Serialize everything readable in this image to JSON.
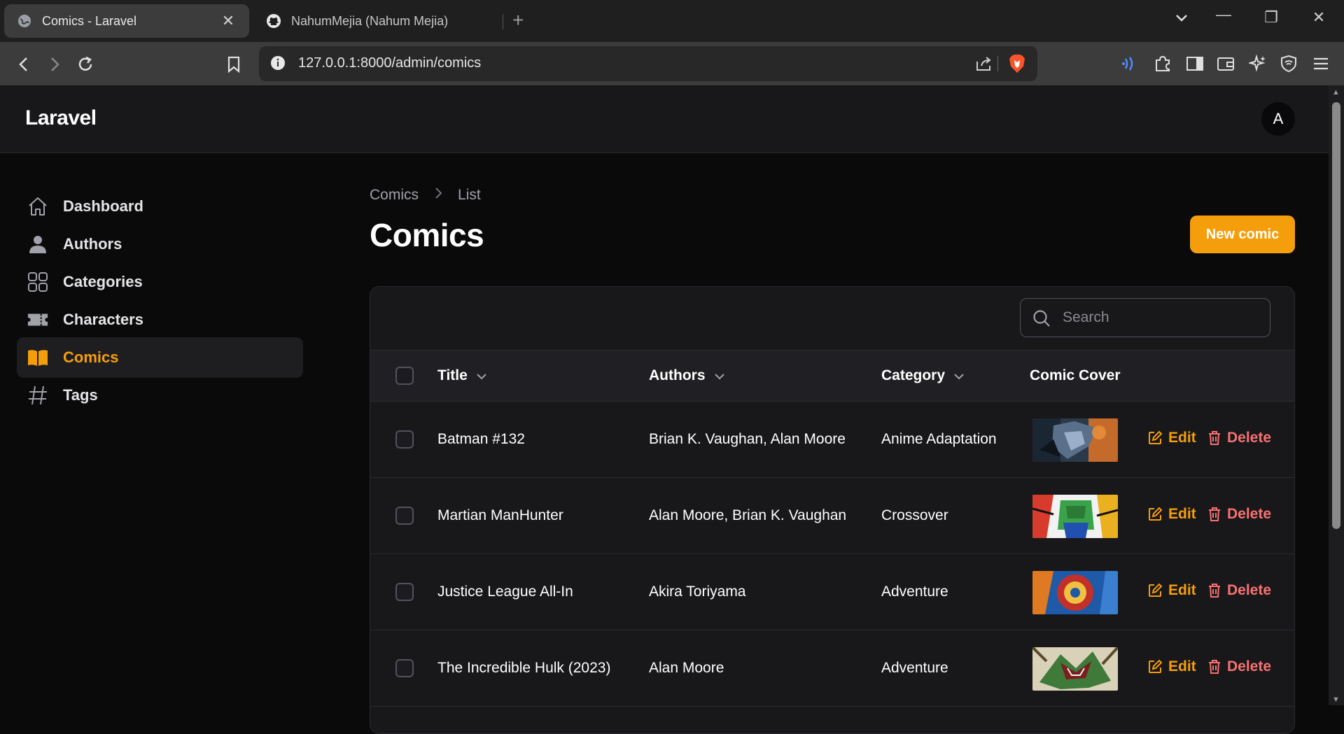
{
  "browser": {
    "tabs": [
      {
        "title": "Comics - Laravel",
        "active": true,
        "close": "✕"
      },
      {
        "title": "NahumMejia (Nahum Mejia)",
        "active": false
      }
    ],
    "new_tab": "+",
    "url": "127.0.0.1:8000/admin/comics",
    "window_controls": {
      "minimize": "—",
      "restore": "❐",
      "close": "✕",
      "tab_search": "⌄"
    }
  },
  "app": {
    "brand": "Laravel",
    "user_initial": "A",
    "accent": "#f59e0b"
  },
  "sidebar": {
    "items": [
      {
        "label": "Dashboard",
        "icon": "home-icon",
        "active": false
      },
      {
        "label": "Authors",
        "icon": "user-icon",
        "active": false
      },
      {
        "label": "Categories",
        "icon": "grid-icon",
        "active": false
      },
      {
        "label": "Characters",
        "icon": "ticket-icon",
        "active": false
      },
      {
        "label": "Comics",
        "icon": "book-icon",
        "active": true
      },
      {
        "label": "Tags",
        "icon": "hash-icon",
        "active": false
      }
    ]
  },
  "page": {
    "breadcrumb": [
      "Comics",
      "List"
    ],
    "title": "Comics",
    "new_button": "New comic",
    "search_placeholder": "Search"
  },
  "table": {
    "columns": [
      "Title",
      "Authors",
      "Category",
      "Comic Cover"
    ],
    "actions": {
      "edit": "Edit",
      "delete": "Delete"
    },
    "rows": [
      {
        "title": "Batman #132",
        "authors": "Brian K. Vaughan, Alan Moore",
        "category": "Anime Adaptation"
      },
      {
        "title": "Martian ManHunter",
        "authors": "Alan Moore, Brian K. Vaughan",
        "category": "Crossover"
      },
      {
        "title": "Justice League All-In",
        "authors": "Akira Toriyama",
        "category": "Adventure"
      },
      {
        "title": "The Incredible Hulk (2023)",
        "authors": "Alan Moore",
        "category": "Adventure"
      }
    ]
  }
}
